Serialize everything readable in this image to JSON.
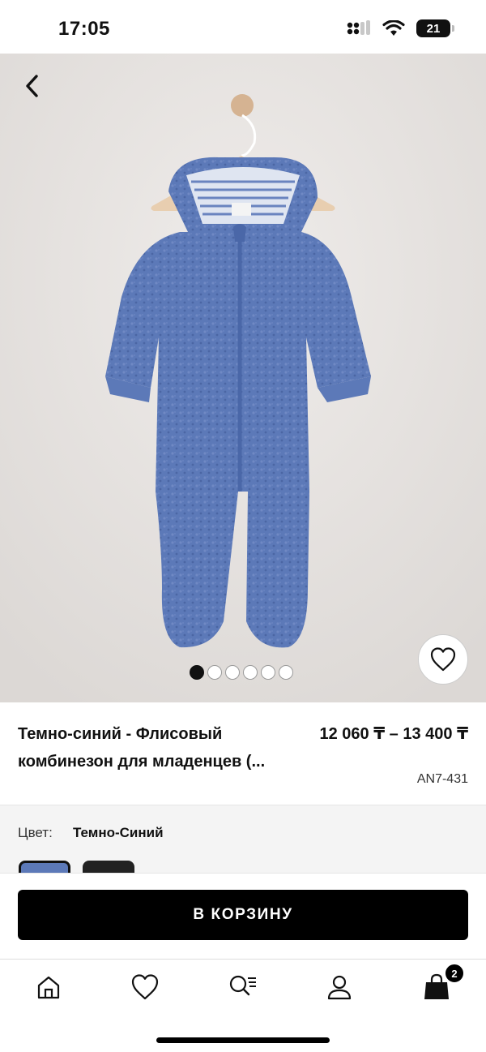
{
  "status_bar": {
    "time": "17:05",
    "battery": "21",
    "icons": [
      "signal-icon",
      "wifi-icon",
      "battery-icon"
    ]
  },
  "gallery": {
    "image_count": 6,
    "active_index": 0,
    "product_color": "#5c79b8"
  },
  "product": {
    "title": "Темно-синий - Флисовый комбинезон для младенцев (...",
    "price": "12 060 ₸ – 13 400 ₸",
    "sku": "AN7-431"
  },
  "color": {
    "label": "Цвет:",
    "value": "Темно-Синий"
  },
  "cta": {
    "label": "В КОРЗИНУ"
  },
  "tabbar": {
    "items": [
      "home-icon",
      "heart-icon",
      "search-list-icon",
      "profile-icon",
      "bag-icon"
    ],
    "cart_count": "2"
  }
}
